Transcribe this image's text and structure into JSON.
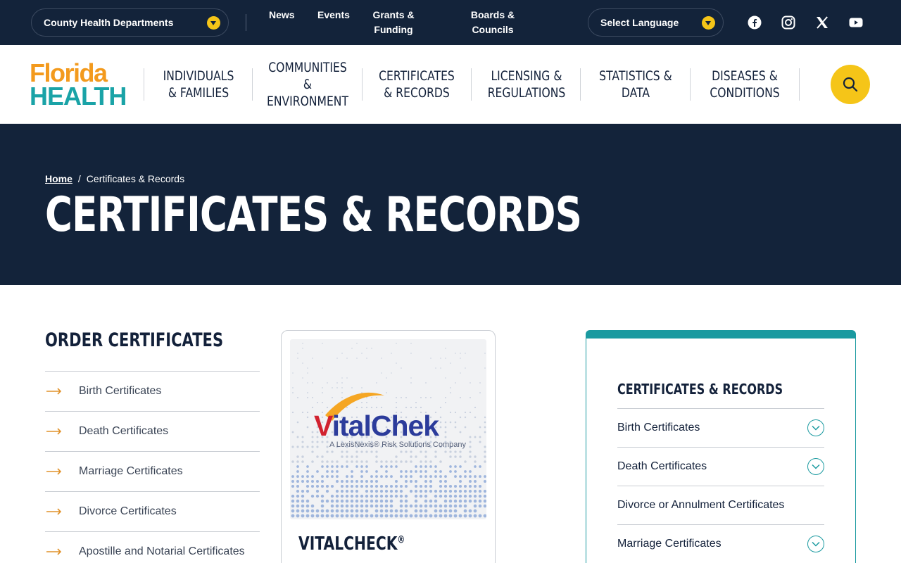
{
  "topbar": {
    "county_label": "County Health Departments",
    "links": [
      "News",
      "Events",
      "Grants & Funding",
      "Boards & Councils"
    ],
    "language_label": "Select Language",
    "social_icons": [
      "facebook-icon",
      "instagram-icon",
      "x-icon",
      "youtube-icon"
    ]
  },
  "logo": {
    "line1": "Florida",
    "line2": "HEALTH"
  },
  "nav": {
    "items": [
      "INDIVIDUALS & FAMILIES",
      "COMMUNITIES & ENVIRONMENT",
      "CERTIFICATES & RECORDS",
      "LICENSING & REGULATIONS",
      "STATISTICS & DATA",
      "DISEASES & CONDITIONS"
    ]
  },
  "hero": {
    "breadcrumb_home": "Home",
    "breadcrumb_sep": "/",
    "breadcrumb_current": "Certificates & Records",
    "title": "CERTIFICATES & RECORDS"
  },
  "order": {
    "title": "ORDER CERTIFICATES",
    "items": [
      "Birth Certificates",
      "Death Certificates",
      "Marriage Certificates",
      "Divorce Certificates",
      "Apostille and Notarial Certificates"
    ]
  },
  "card": {
    "logo_text_v": "V",
    "logo_text_rest": "italChek",
    "logo_sub": "A LexisNexis® Risk Solutions Company",
    "title": "VITALCHECK",
    "title_sup": "®"
  },
  "panel": {
    "title": "CERTIFICATES & RECORDS",
    "items": [
      {
        "label": "Birth Certificates",
        "expandable": true
      },
      {
        "label": "Death Certificates",
        "expandable": true
      },
      {
        "label": "Divorce or Annulment Certificates",
        "expandable": false
      },
      {
        "label": "Marriage Certificates",
        "expandable": true
      }
    ]
  },
  "colors": {
    "navy": "#13233a",
    "yellow": "#f5c518",
    "orange": "#f39a1d",
    "teal": "#1aa3a7"
  }
}
